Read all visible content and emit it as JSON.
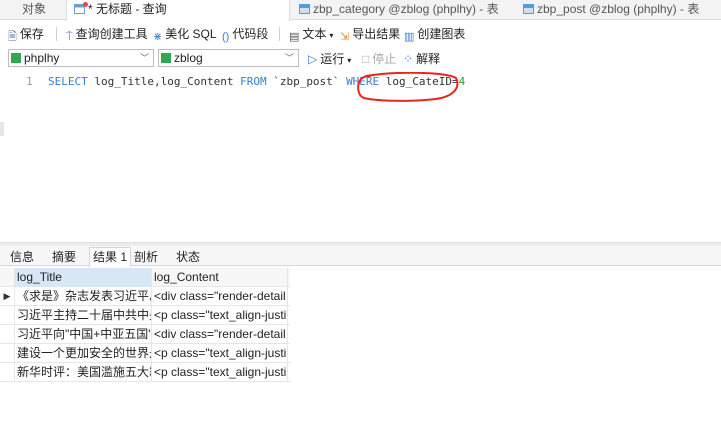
{
  "tabs": [
    {
      "label": "对象"
    },
    {
      "label": "* 无标题 - 查询"
    },
    {
      "label": "zbp_category @zblog (phplhy) - 表"
    },
    {
      "label": "zbp_post @zblog (phplhy) - 表"
    }
  ],
  "toolbar": {
    "save": "保存",
    "query_builder": "查询创建工具",
    "beautify": "美化 SQL",
    "snippet": "代码段",
    "text": "文本",
    "export": "导出结果",
    "create_chart": "创建图表"
  },
  "conn": {
    "connection": "phplhy",
    "database": "zblog",
    "run": "运行",
    "stop": "停止",
    "explain": "解释"
  },
  "editor": {
    "line_number": "1",
    "tokens": {
      "select": "SELECT",
      "cols": " log_Title,log_Content ",
      "from": "FROM",
      "table": " `zbp_post` ",
      "where": "WHERE",
      "cond": " log_CateID=",
      "value": "4"
    }
  },
  "result_tabs": [
    "信息",
    "摘要",
    "结果 1",
    "剖析",
    "状态"
  ],
  "grid": {
    "columns": [
      "log_Title",
      "log_Content"
    ],
    "rows": [
      [
        "《求是》杂志发表习近平总",
        "<div class=\"render-detail"
      ],
      [
        "习近平主持二十届中共中央",
        "<p class=\"text_align-justi"
      ],
      [
        "习近平向\"中国+中亚五国\"",
        "<div class=\"render-detail"
      ],
      [
        "建设一个更加安全的世界是",
        "<p class=\"text_align-justi"
      ],
      [
        "新华时评：美国滥施五大霸",
        "<p class=\"text_align-justi"
      ]
    ]
  },
  "colors": {
    "keyword": "#3b7bd6",
    "number": "#2a9d2a",
    "annotation": "#e8261c",
    "selected_header": "#d8e7f6"
  }
}
